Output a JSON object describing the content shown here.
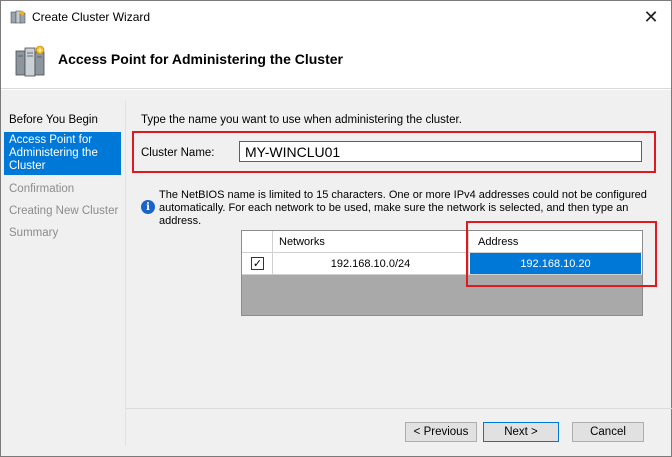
{
  "window": {
    "title": "Create Cluster Wizard",
    "close_symbol": "✕"
  },
  "header": {
    "title": "Access Point for Administering the Cluster",
    "icon": "cluster-servers-icon"
  },
  "nav": {
    "items": [
      {
        "label": "Before You Begin",
        "state": "normal"
      },
      {
        "label": "Access Point for Administering the Cluster",
        "state": "active"
      },
      {
        "label": "Confirmation",
        "state": "disabled"
      },
      {
        "label": "Creating New Cluster",
        "state": "disabled"
      },
      {
        "label": "Summary",
        "state": "disabled"
      }
    ]
  },
  "main": {
    "instruction": "Type the name you want to use when administering the cluster.",
    "cluster_name_label": "Cluster Name:",
    "cluster_name_value": "MY-WINCLU01",
    "info_text": "The NetBIOS name is limited to 15 characters.  One or more IPv4 addresses could not be configured automatically.  For each network to be used, make sure the network is selected, and then type an address.",
    "grid": {
      "headers": {
        "networks": "Networks",
        "address": "Address"
      },
      "rows": [
        {
          "checked": true,
          "check_symbol": "✓",
          "network": "192.168.10.0/24",
          "address": "192.168.10.20"
        }
      ]
    }
  },
  "footer": {
    "previous_label": "< Previous",
    "next_label": "Next >",
    "cancel_label": "Cancel"
  },
  "colors": {
    "accent": "#0078d7",
    "highlight": "#e0191f"
  }
}
